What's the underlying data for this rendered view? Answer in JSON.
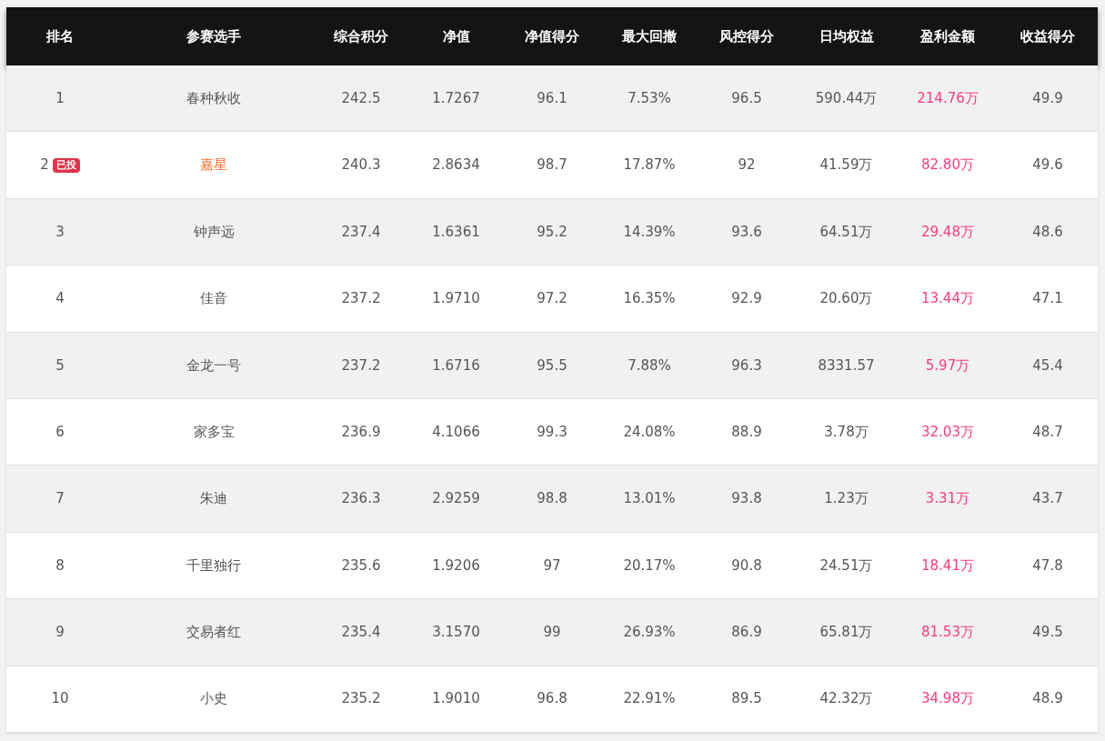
{
  "table": {
    "columns": [
      "排名",
      "参赛选手",
      "综合积分",
      "净值",
      "净值得分",
      "最大回撤",
      "风控得分",
      "日均权益",
      "盈利金额",
      "收益得分"
    ],
    "rows": [
      {
        "highlighted": false,
        "cells": [
          "1",
          "春种秋收",
          "242.5",
          "1.7267",
          "96.1",
          "7.53%",
          "96.5",
          "590.44万",
          "214.76万",
          "49.9"
        ]
      },
      {
        "badge": "已投",
        "highlighted": true,
        "cells": [
          "2",
          "嘉星",
          "240.3",
          "2.8634",
          "98.7",
          "17.87%",
          "92",
          "41.59万",
          "82.80万",
          "49.6"
        ]
      },
      {
        "highlighted": false,
        "cells": [
          "3",
          "钟声远",
          "237.4",
          "1.6361",
          "95.2",
          "14.39%",
          "93.6",
          "64.51万",
          "29.48万",
          "48.6"
        ]
      },
      {
        "highlighted": false,
        "cells": [
          "4",
          "佳音",
          "237.2",
          "1.9710",
          "97.2",
          "16.35%",
          "92.9",
          "20.60万",
          "13.44万",
          "47.1"
        ]
      },
      {
        "highlighted": false,
        "cells": [
          "5",
          "金龙一号",
          "237.2",
          "1.6716",
          "95.5",
          "7.88%",
          "96.3",
          "8331.57",
          "5.97万",
          "45.4"
        ]
      },
      {
        "highlighted": false,
        "cells": [
          "6",
          "家多宝",
          "236.9",
          "4.1066",
          "99.3",
          "24.08%",
          "88.9",
          "3.78万",
          "32.03万",
          "48.7"
        ]
      },
      {
        "highlighted": false,
        "cells": [
          "7",
          "朱迪",
          "236.3",
          "2.9259",
          "98.8",
          "13.01%",
          "93.8",
          "1.23万",
          "3.31万",
          "43.7"
        ]
      },
      {
        "highlighted": false,
        "cells": [
          "8",
          "千里独行",
          "235.6",
          "1.9206",
          "97",
          "20.17%",
          "90.8",
          "24.51万",
          "18.41万",
          "47.8"
        ]
      },
      {
        "highlighted": false,
        "cells": [
          "9",
          "交易者红",
          "235.4",
          "3.1570",
          "99",
          "26.93%",
          "86.9",
          "65.81万",
          "81.53万",
          "49.5"
        ]
      },
      {
        "highlighted": false,
        "cells": [
          "10",
          "小史",
          "235.2",
          "1.9010",
          "96.8",
          "22.91%",
          "89.5",
          "42.32万",
          "34.98万",
          "48.9"
        ]
      }
    ]
  }
}
